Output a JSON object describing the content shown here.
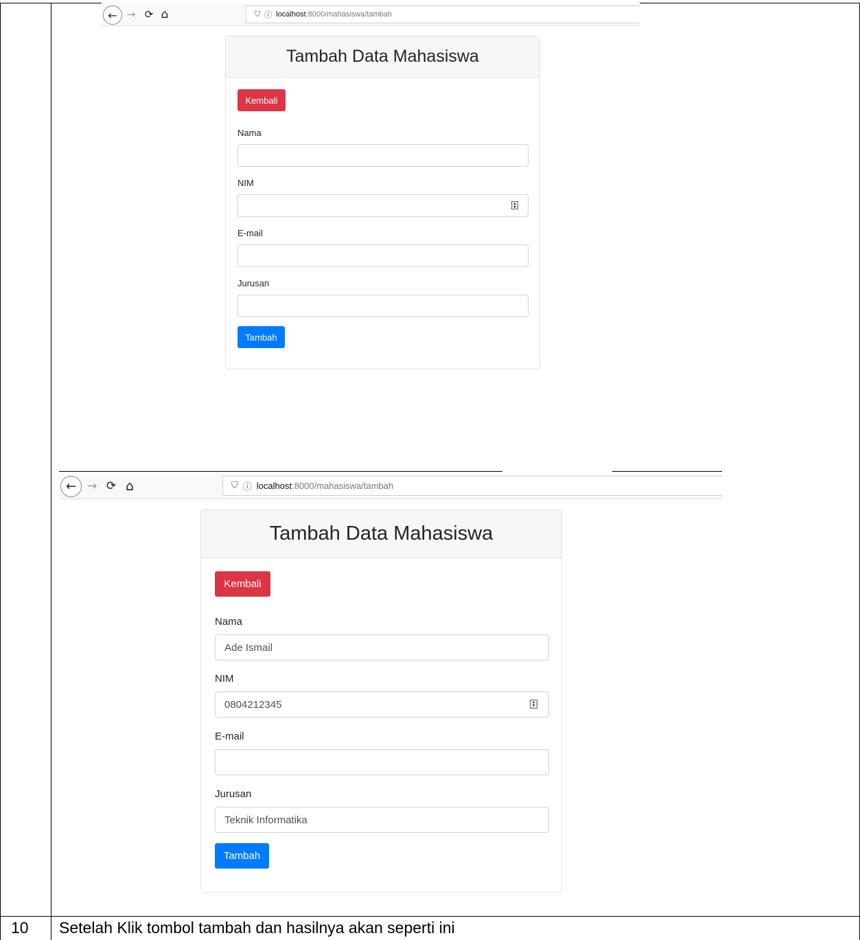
{
  "browser": {
    "back_icon": "←",
    "forward_icon": "→",
    "reload_icon": "⟳",
    "home_icon": "⌂",
    "shield_icon": "⛉",
    "info_icon": "ⓘ",
    "url_host": "localhost",
    "url_path": ":8000/mahasiswa/tambah"
  },
  "form_empty": {
    "title": "Tambah Data Mahasiswa",
    "back_button": "Kembali",
    "nama_label": "Nama",
    "nama_value": "",
    "nim_label": "NIM",
    "nim_value": "",
    "email_label": "E-mail",
    "email_value": "",
    "jurusan_label": "Jurusan",
    "jurusan_value": "",
    "submit_button": "Tambah"
  },
  "form_filled": {
    "title": "Tambah Data Mahasiswa",
    "back_button": "Kembali",
    "nama_label": "Nama",
    "nama_value": "Ade Ismail",
    "nim_label": "NIM",
    "nim_value": "0804212345",
    "email_label": "E-mail",
    "email_value": "",
    "jurusan_label": "Jurusan",
    "jurusan_value": "Teknik Informatika",
    "submit_button": "Tambah"
  },
  "row": {
    "number": "10",
    "description": "Setelah Klik tombol tambah dan hasilnya akan seperti ini"
  },
  "colors": {
    "danger": "#dc3545",
    "primary": "#007bff",
    "card_header_bg": "#f7f7f7"
  }
}
